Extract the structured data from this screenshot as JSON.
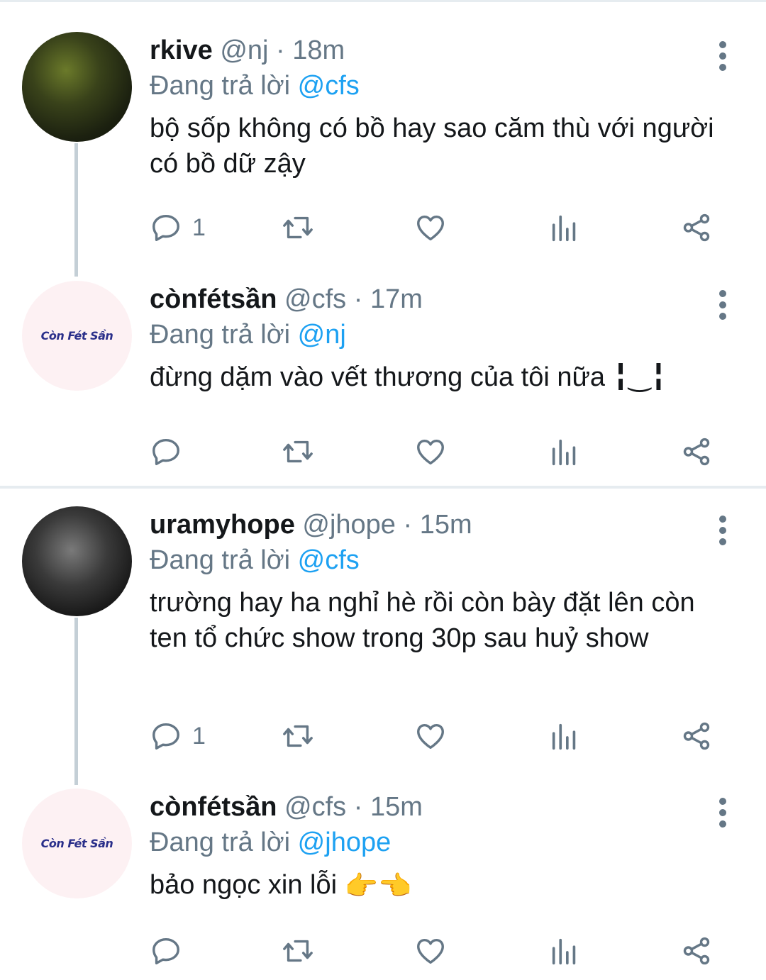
{
  "tweets": [
    {
      "display_name": "rkive",
      "handle": "@nj",
      "time": "18m",
      "reply_prefix": "Đang trả lời",
      "reply_to": "@cfs",
      "text": "bộ sốp không có bồ hay sao căm thù với người có bồ dữ zậy",
      "reply_count": "1",
      "avatar": "photo"
    },
    {
      "display_name": "cònfétsần",
      "handle": "@cfs",
      "time": "17m",
      "reply_prefix": "Đang trả lời",
      "reply_to": "@nj",
      "text": "đừng dặm vào vết thương của tôi nữa ╏‿╏",
      "reply_count": "",
      "avatar_text": "Còn Fét Sần"
    },
    {
      "display_name": "uramyhope",
      "handle": "@jhope",
      "time": "15m",
      "reply_prefix": "Đang trả lời",
      "reply_to": "@cfs",
      "text": "trường hay ha nghỉ hè rồi còn bày đặt lên còn ten tổ chức show trong 30p sau huỷ show",
      "reply_count": "1",
      "avatar": "photo"
    },
    {
      "display_name": "cònfétsần",
      "handle": "@cfs",
      "time": "15m",
      "reply_prefix": "Đang trả lời",
      "reply_to": "@jhope",
      "text": "bảo ngọc xin lỗi",
      "emoji": "👉👈",
      "reply_count": "",
      "avatar_text": "Còn Fét Sần"
    }
  ],
  "separator": " · ",
  "icons": [
    "reply-icon",
    "retweet-icon",
    "like-icon",
    "analytics-icon",
    "share-icon",
    "more-icon"
  ],
  "colors": {
    "accent": "#1da1f2",
    "muted": "#657786",
    "text": "#14171a",
    "thread_line": "#c4cfd6"
  }
}
